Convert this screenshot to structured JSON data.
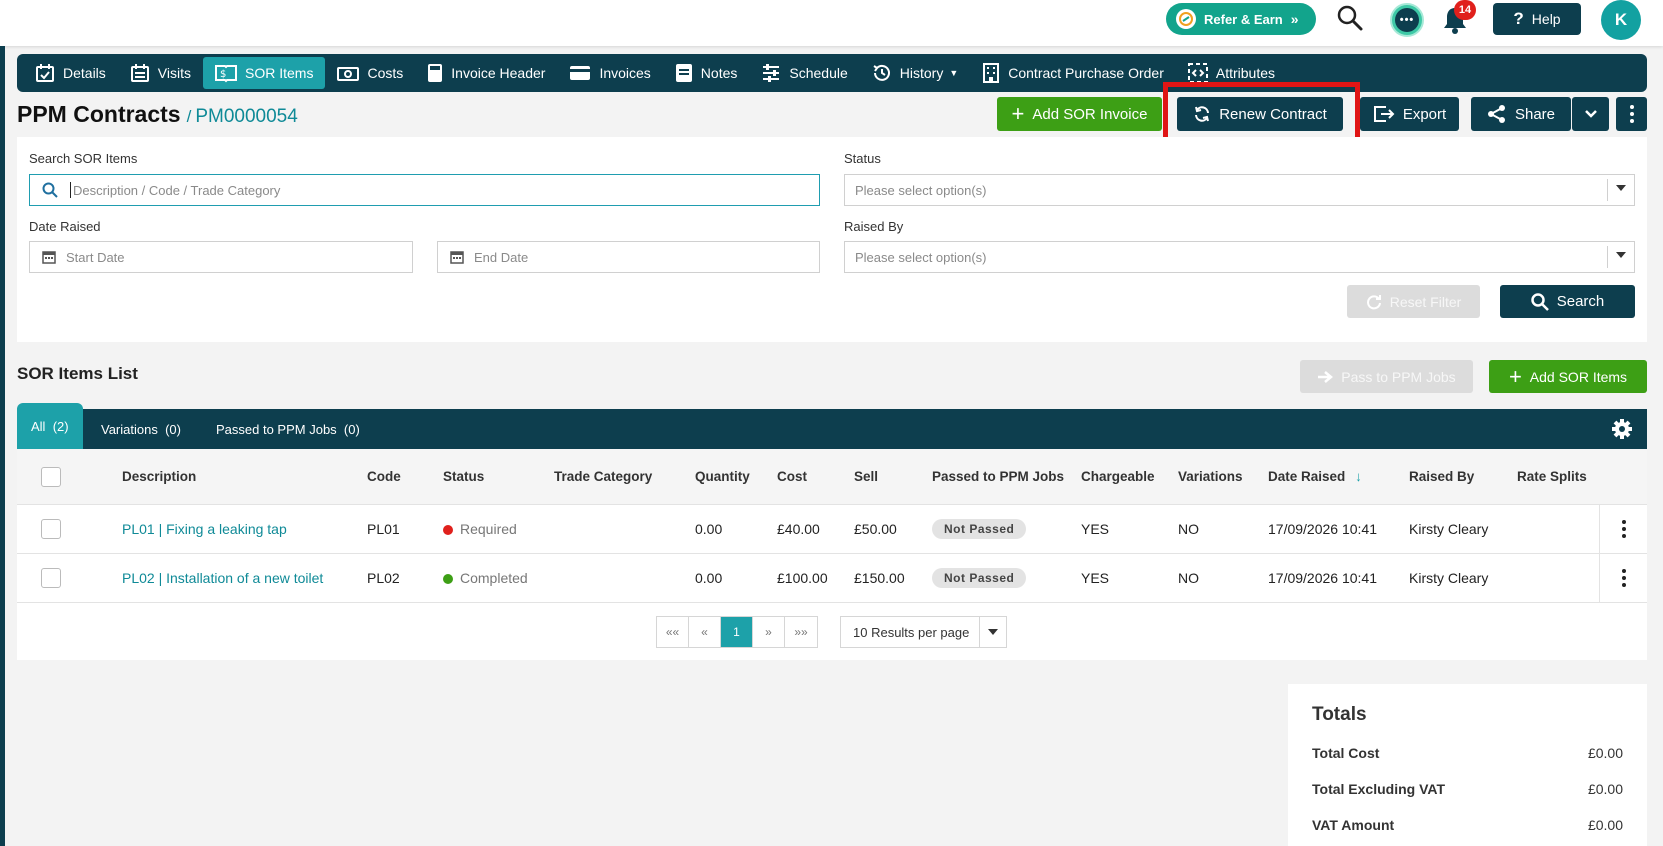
{
  "header": {
    "refer_label": "Refer & Earn",
    "notification_count": "14",
    "help_label": "Help",
    "avatar_initial": "K"
  },
  "tabs": [
    {
      "label": "Details",
      "icon": "calendar-check-icon"
    },
    {
      "label": "Visits",
      "icon": "calendar-list-icon"
    },
    {
      "label": "SOR Items",
      "icon": "book-dollar-icon",
      "active": true
    },
    {
      "label": "Costs",
      "icon": "money-icon"
    },
    {
      "label": "Invoice Header",
      "icon": "calculator-icon"
    },
    {
      "label": "Invoices",
      "icon": "credit-card-icon"
    },
    {
      "label": "Notes",
      "icon": "note-icon"
    },
    {
      "label": "Schedule",
      "icon": "sliders-icon"
    },
    {
      "label": "History",
      "icon": "history-icon"
    },
    {
      "label": "Contract Purchase Order",
      "icon": "building-icon"
    },
    {
      "label": "Attributes",
      "icon": "code-icon"
    }
  ],
  "page": {
    "title": "PPM Contracts",
    "separator": "/",
    "reference": "PM0000054"
  },
  "actions": {
    "add_sor_invoice": "Add SOR Invoice",
    "renew_contract": "Renew Contract",
    "export": "Export",
    "share": "Share"
  },
  "filters": {
    "search_label": "Search SOR Items",
    "search_placeholder": "Description / Code / Trade Category",
    "status_label": "Status",
    "status_placeholder": "Please select option(s)",
    "date_raised_label": "Date Raised",
    "start_placeholder": "Start Date",
    "end_placeholder": "End Date",
    "raised_by_label": "Raised By",
    "raised_by_placeholder": "Please select option(s)",
    "reset_label": "Reset Filter",
    "search_button": "Search"
  },
  "list": {
    "title": "SOR Items List",
    "pass_button": "Pass to PPM Jobs",
    "add_button": "Add SOR Items",
    "tabs": [
      {
        "label": "All",
        "count": "(2)"
      },
      {
        "label": "Variations",
        "count": "(0)"
      },
      {
        "label": "Passed to PPM Jobs",
        "count": "(0)"
      }
    ],
    "columns": [
      "Description",
      "Code",
      "Status",
      "Trade Category",
      "Quantity",
      "Cost",
      "Sell",
      "Passed to PPM Jobs",
      "Chargeable",
      "Variations",
      "Date Raised",
      "Raised By",
      "Rate Splits"
    ],
    "rows": [
      {
        "description": "PL01 | Fixing a leaking tap",
        "code": "PL01",
        "status": "Required",
        "status_color": "#e0201c",
        "trade": "",
        "quantity": "0.00",
        "cost": "£40.00",
        "sell": "£50.00",
        "passed": "Not Passed",
        "chargeable": "YES",
        "variations": "NO",
        "date_raised": "17/09/2026 10:41",
        "raised_by": "Kirsty Cleary",
        "rate_splits": ""
      },
      {
        "description": "PL02 | Installation of a new toilet",
        "code": "PL02",
        "status": "Completed",
        "status_color": "#3d9f15",
        "trade": "",
        "quantity": "0.00",
        "cost": "£100.00",
        "sell": "£150.00",
        "passed": "Not Passed",
        "chargeable": "YES",
        "variations": "NO",
        "date_raised": "17/09/2026 10:41",
        "raised_by": "Kirsty Cleary",
        "rate_splits": ""
      }
    ],
    "pager": {
      "first": "««",
      "prev": "«",
      "page": "1",
      "next": "»",
      "last": "»»",
      "per_page": "10 Results per page"
    }
  },
  "totals": {
    "title": "Totals",
    "rows": [
      {
        "label": "Total Cost",
        "value": "£0.00"
      },
      {
        "label": "Total Excluding VAT",
        "value": "£0.00"
      },
      {
        "label": "VAT Amount",
        "value": "£0.00"
      }
    ]
  },
  "colors": {
    "navy": "#0d3e4e",
    "teal": "#1da1a9",
    "green": "#3d9f15",
    "highlight": "#e01515"
  }
}
